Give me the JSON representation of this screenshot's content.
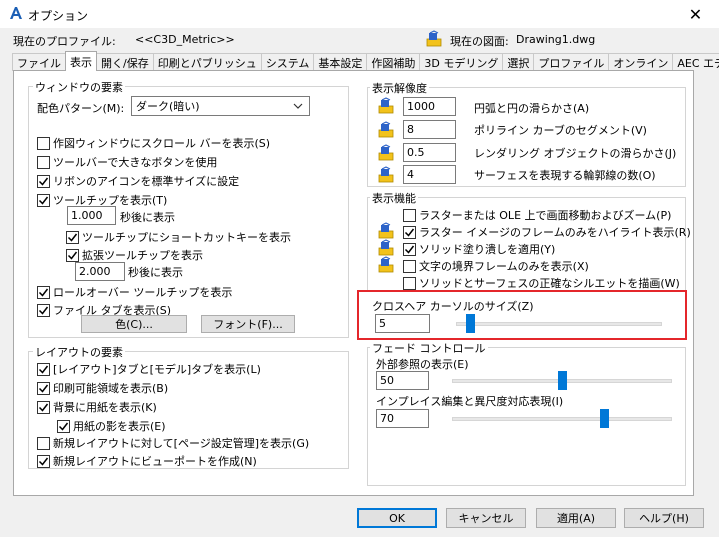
{
  "window": {
    "title": "オプション",
    "close_glyph": "✕"
  },
  "header": {
    "profile_label": "現在のプロファイル:",
    "profile_value": "<<C3D_Metric>>",
    "drawing_label": "現在の図面:",
    "drawing_value": "Drawing1.dwg"
  },
  "tabs": [
    {
      "label": "ファイル",
      "active": false
    },
    {
      "label": "表示",
      "active": true
    },
    {
      "label": "開く/保存",
      "active": false
    },
    {
      "label": "印刷とパブリッシュ",
      "active": false
    },
    {
      "label": "システム",
      "active": false
    },
    {
      "label": "基本設定",
      "active": false
    },
    {
      "label": "作図補助",
      "active": false
    },
    {
      "label": "3D モデリング",
      "active": false
    },
    {
      "label": "選択",
      "active": false
    },
    {
      "label": "プロファイル",
      "active": false
    },
    {
      "label": "オンライン",
      "active": false
    },
    {
      "label": "AEC エディタ",
      "active": false
    }
  ],
  "window_elements": {
    "title": "ウィンドウの要素",
    "color_scheme_label": "配色パターン(M):",
    "color_scheme_value": "ダーク(暗い)",
    "scrollbars": {
      "label": "作図ウィンドウにスクロール バーを表示(S)",
      "checked": false
    },
    "large_buttons": {
      "label": "ツールバーで大きなボタンを使用",
      "checked": false
    },
    "ribbon_icons": {
      "label": "リボンのアイコンを標準サイズに設定",
      "checked": true
    },
    "tooltips": {
      "label": "ツールチップを表示(T)",
      "checked": true
    },
    "tooltip_delay_value": "1.000",
    "tooltip_delay_label": "秒後に表示",
    "shortcut_keys": {
      "label": "ツールチップにショートカットキーを表示",
      "checked": true
    },
    "ext_tooltips": {
      "label": "拡張ツールチップを表示",
      "checked": true
    },
    "ext_delay_value": "2.000",
    "ext_delay_label": "秒後に表示",
    "rollover": {
      "label": "ロールオーバー ツールチップを表示",
      "checked": true
    },
    "file_tabs": {
      "label": "ファイル タブを表示(S)",
      "checked": true
    },
    "colors_button": "色(C)...",
    "fonts_button": "フォント(F)..."
  },
  "layout_elements": {
    "title": "レイアウトの要素",
    "items": [
      {
        "label": "[レイアウト]タブと[モデル]タブを表示(L)",
        "checked": true
      },
      {
        "label": "印刷可能領域を表示(B)",
        "checked": true
      },
      {
        "label": "背景に用紙を表示(K)",
        "checked": true
      },
      {
        "label": "用紙の影を表示(E)",
        "checked": true
      },
      {
        "label": "新規レイアウトに対して[ページ設定管理]を表示(G)",
        "checked": false
      },
      {
        "label": "新規レイアウトにビューポートを作成(N)",
        "checked": true
      }
    ]
  },
  "display_resolution": {
    "title": "表示解像度",
    "items": [
      {
        "value": "1000",
        "label": "円弧と円の滑らかさ(A)"
      },
      {
        "value": "8",
        "label": "ポリライン カーブのセグメント(V)"
      },
      {
        "value": "0.5",
        "label": "レンダリング オブジェクトの滑らかさ(J)"
      },
      {
        "value": "4",
        "label": "サーフェスを表現する輪郭線の数(O)"
      }
    ]
  },
  "display_performance": {
    "title": "表示機能",
    "items": [
      {
        "label": "ラスターまたは OLE 上で画面移動およびズーム(P)",
        "checked": false
      },
      {
        "label": "ラスター イメージのフレームのみをハイライト表示(R)",
        "checked": true
      },
      {
        "label": "ソリッド塗り潰しを適用(Y)",
        "checked": true
      },
      {
        "label": "文字の境界フレームのみを表示(X)",
        "checked": false
      },
      {
        "label": "ソリッドとサーフェスの正確なシルエットを描画(W)",
        "checked": false
      }
    ]
  },
  "crosshair": {
    "title": "クロスヘア カーソルのサイズ(Z)",
    "value": "5",
    "level_percent": 5
  },
  "fade_control": {
    "title": "フェード コントロール",
    "xref_label": "外部参照の表示(E)",
    "xref_value": "50",
    "xref_level_percent": 50,
    "inplace_label": "インプレイス編集と異尺度対応表現(I)",
    "inplace_value": "70",
    "inplace_level_percent": 70
  },
  "footer": {
    "ok": "OK",
    "cancel": "キャンセル",
    "apply": "適用(A)",
    "help": "ヘルプ(H)"
  },
  "colors": {
    "accent": "#0078d7",
    "highlight": "#e4262b"
  }
}
